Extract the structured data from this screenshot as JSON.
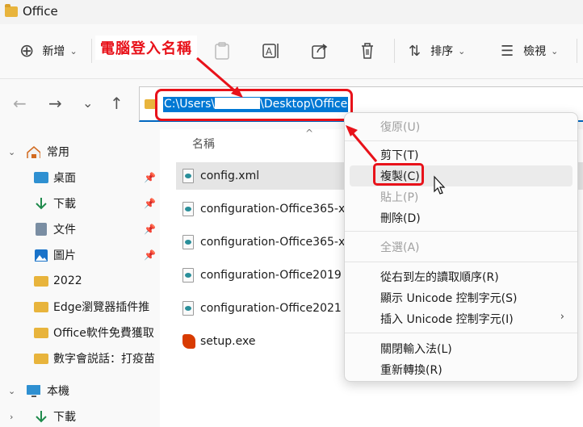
{
  "window": {
    "title": "Office"
  },
  "toolbar": {
    "new_label": "新增",
    "sort_label": "排序",
    "view_label": "檢視"
  },
  "annotation": {
    "label": "電腦登入名稱"
  },
  "address": {
    "prefix": "C:\\Users\\",
    "suffix": "\\Desktop\\Office"
  },
  "nav": {
    "home": "常用",
    "items": [
      {
        "label": "桌面",
        "pinned": true
      },
      {
        "label": "下載",
        "pinned": true
      },
      {
        "label": "文件",
        "pinned": true
      },
      {
        "label": "圖片",
        "pinned": true
      },
      {
        "label": "2022"
      },
      {
        "label": "Edge瀏覽器插件推"
      },
      {
        "label": "Office軟件免費獲取"
      },
      {
        "label": "數字會説話：打疫苗"
      }
    ],
    "this_pc": "本機",
    "this_pc_download": "下載"
  },
  "content": {
    "column_name": "名稱",
    "files": [
      {
        "name": "config.xml",
        "selected": true
      },
      {
        "name": "configuration-Office365-x"
      },
      {
        "name": "configuration-Office365-x"
      },
      {
        "name": "configuration-Office2019"
      },
      {
        "name": "configuration-Office2021"
      },
      {
        "name": "setup.exe"
      }
    ]
  },
  "context_menu": {
    "items": [
      {
        "label": "復原(U)",
        "disabled": true
      },
      {
        "label": "剪下(T)"
      },
      {
        "label": "複製(C)",
        "highlighted": true
      },
      {
        "label": "貼上(P)",
        "disabled": true
      },
      {
        "label": "刪除(D)"
      },
      {
        "label": "全選(A)",
        "disabled": true
      },
      {
        "label": "從右到左的讀取順序(R)"
      },
      {
        "label": "顯示 Unicode 控制字元(S)"
      },
      {
        "label": "插入 Unicode 控制字元(I)",
        "submenu": true
      },
      {
        "label": "關閉輸入法(L)"
      },
      {
        "label": "重新轉換(R)"
      }
    ]
  },
  "colors": {
    "accent": "#0078d4",
    "annotation": "#e8121a"
  }
}
